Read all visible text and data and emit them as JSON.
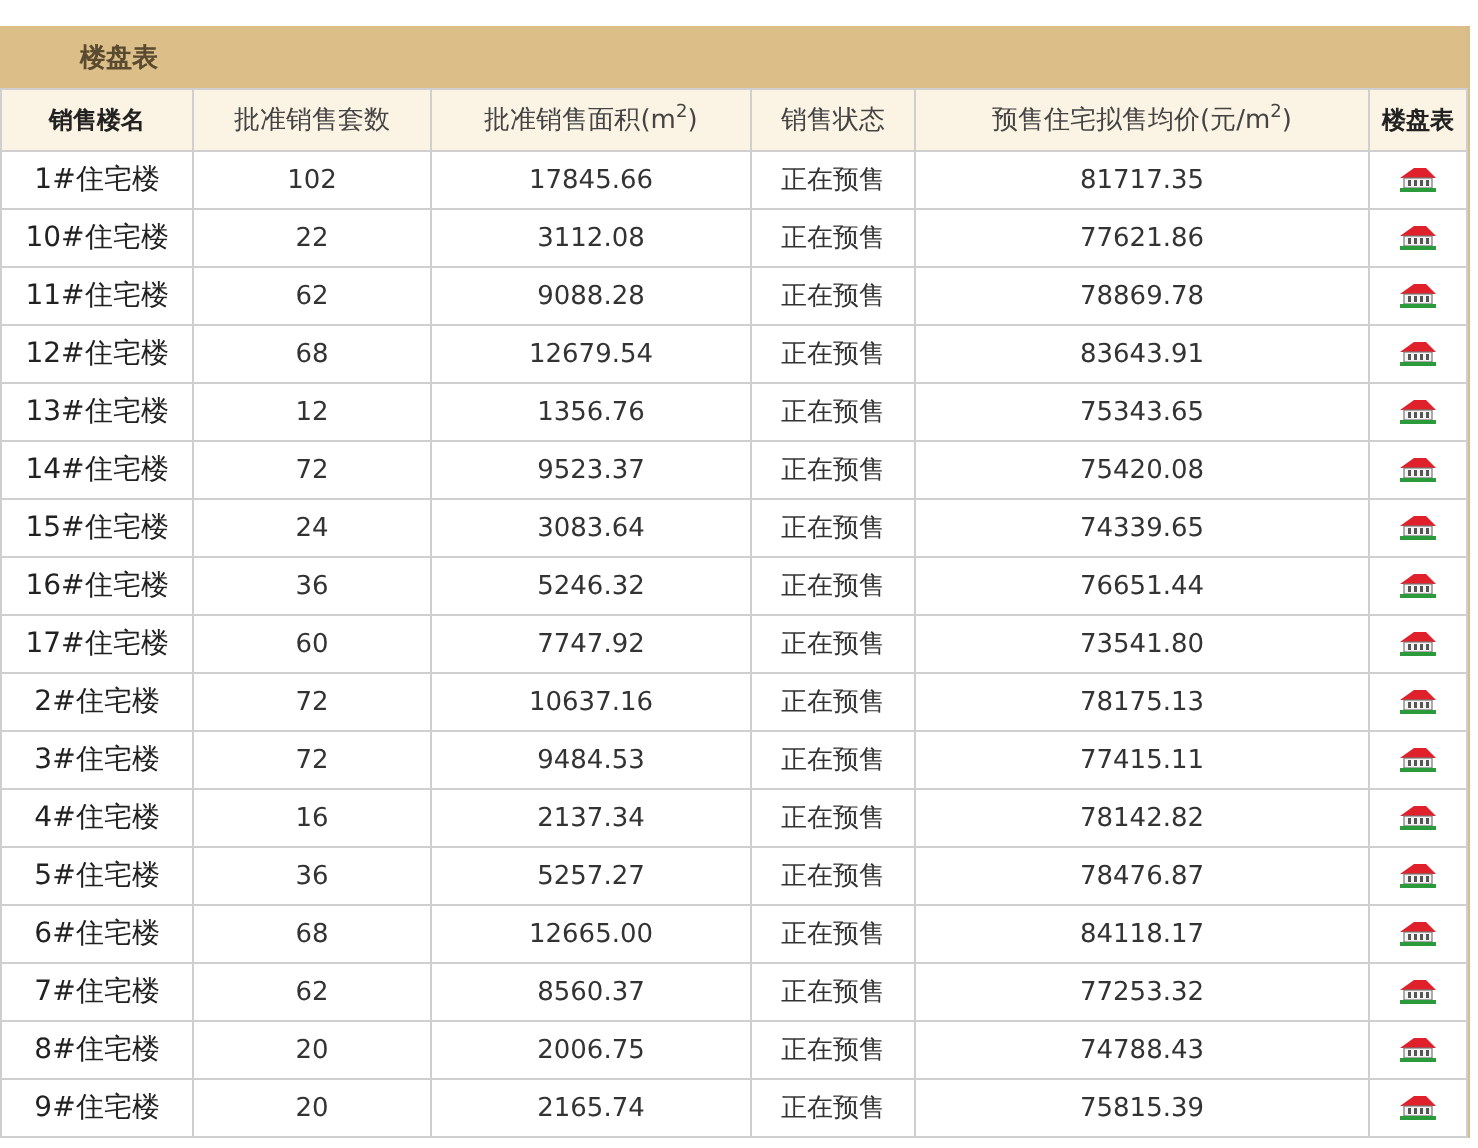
{
  "panel": {
    "title": "楼盘表"
  },
  "table": {
    "columns": [
      {
        "label": "销售楼名",
        "bold": true
      },
      {
        "label": "批准销售套数",
        "bold": false
      },
      {
        "label": "批准销售面积(m$^{2}$)",
        "bold": false
      },
      {
        "label": "销售状态",
        "bold": false
      },
      {
        "label": "预售住宅拟售均价(元/m$^{2}$)",
        "bold": false
      },
      {
        "label": "楼盘表",
        "bold": true
      }
    ],
    "rows": [
      {
        "name": "1#住宅楼",
        "units": "102",
        "area": "17845.66",
        "status": "正在预售",
        "price": "81717.35"
      },
      {
        "name": "10#住宅楼",
        "units": "22",
        "area": "3112.08",
        "status": "正在预售",
        "price": "77621.86"
      },
      {
        "name": "11#住宅楼",
        "units": "62",
        "area": "9088.28",
        "status": "正在预售",
        "price": "78869.78"
      },
      {
        "name": "12#住宅楼",
        "units": "68",
        "area": "12679.54",
        "status": "正在预售",
        "price": "83643.91"
      },
      {
        "name": "13#住宅楼",
        "units": "12",
        "area": "1356.76",
        "status": "正在预售",
        "price": "75343.65"
      },
      {
        "name": "14#住宅楼",
        "units": "72",
        "area": "9523.37",
        "status": "正在预售",
        "price": "75420.08"
      },
      {
        "name": "15#住宅楼",
        "units": "24",
        "area": "3083.64",
        "status": "正在预售",
        "price": "74339.65"
      },
      {
        "name": "16#住宅楼",
        "units": "36",
        "area": "5246.32",
        "status": "正在预售",
        "price": "76651.44"
      },
      {
        "name": "17#住宅楼",
        "units": "60",
        "area": "7747.92",
        "status": "正在预售",
        "price": "73541.80"
      },
      {
        "name": "2#住宅楼",
        "units": "72",
        "area": "10637.16",
        "status": "正在预售",
        "price": "78175.13"
      },
      {
        "name": "3#住宅楼",
        "units": "72",
        "area": "9484.53",
        "status": "正在预售",
        "price": "77415.11"
      },
      {
        "name": "4#住宅楼",
        "units": "16",
        "area": "2137.34",
        "status": "正在预售",
        "price": "78142.82"
      },
      {
        "name": "5#住宅楼",
        "units": "36",
        "area": "5257.27",
        "status": "正在预售",
        "price": "78476.87"
      },
      {
        "name": "6#住宅楼",
        "units": "68",
        "area": "12665.00",
        "status": "正在预售",
        "price": "84118.17"
      },
      {
        "name": "7#住宅楼",
        "units": "62",
        "area": "8560.37",
        "status": "正在预售",
        "price": "77253.32"
      },
      {
        "name": "8#住宅楼",
        "units": "20",
        "area": "2006.75",
        "status": "正在预售",
        "price": "74788.43"
      },
      {
        "name": "9#住宅楼",
        "units": "20",
        "area": "2165.74",
        "status": "正在预售",
        "price": "75815.39"
      }
    ]
  }
}
